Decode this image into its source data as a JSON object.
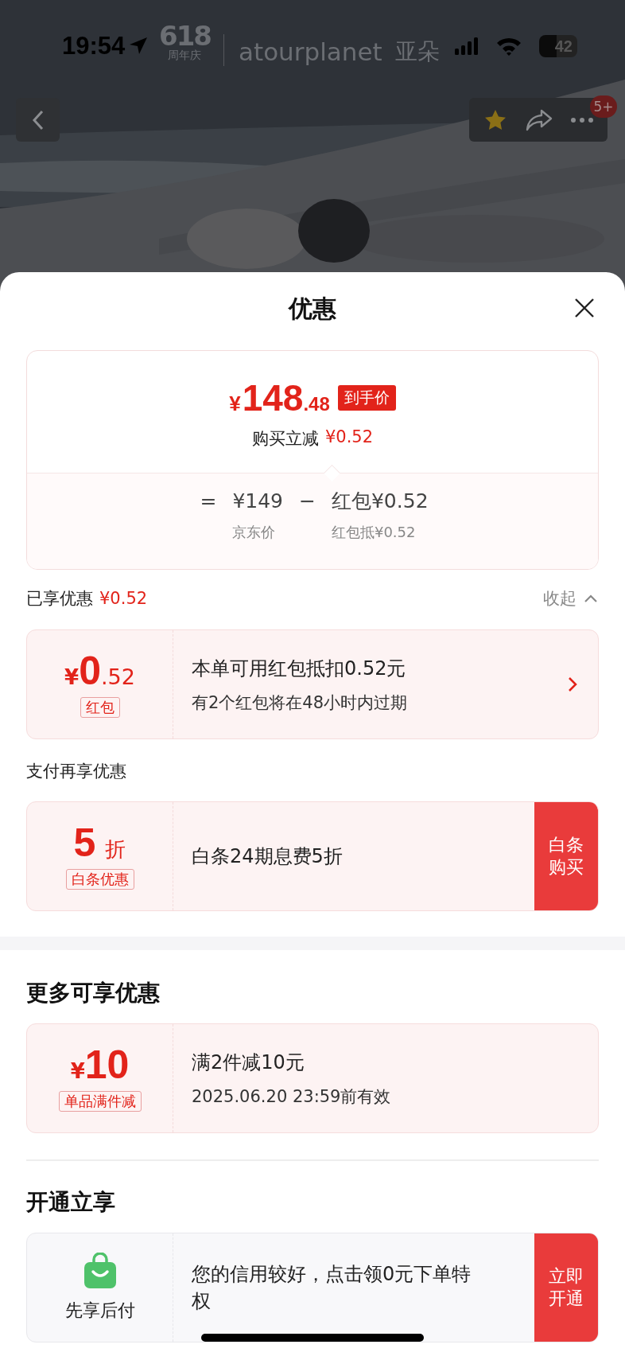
{
  "status_bar": {
    "time": "19:54",
    "battery": "42"
  },
  "brand": {
    "event_number": "618",
    "event_label": "周年庆",
    "name": "atourplanet",
    "name_cn": "亚朵"
  },
  "nav": {
    "favorited": true,
    "badge": "5+"
  },
  "sheet": {
    "title": "优惠"
  },
  "price_card": {
    "currency": "¥",
    "integer": "148",
    "decimal": ".48",
    "price_badge": "到手价",
    "saving_label": "购买立减",
    "saving_amount": "¥0.52",
    "breakdown": [
      {
        "kind": "operator",
        "text": "="
      },
      {
        "kind": "term",
        "value": "¥149",
        "caption": "京东价"
      },
      {
        "kind": "operator",
        "text": "−"
      },
      {
        "kind": "term",
        "value": "红包¥0.52",
        "caption": "红包抵¥0.52"
      }
    ]
  },
  "applied": {
    "label": "已享优惠",
    "amount": "¥0.52",
    "toggle": "收起",
    "expanded": true,
    "coupons": [
      {
        "kind": "coupon",
        "left": {
          "kind": "amount",
          "currency": "¥",
          "integer": "0",
          "decimal": ".52",
          "tag": "红包"
        },
        "lines": [
          "本单可用红包抵扣0.52元",
          "有2个红包将在48小时内过期"
        ],
        "action": {
          "kind": "chevron"
        }
      }
    ]
  },
  "payment": {
    "label": "支付再享优惠",
    "coupons": [
      {
        "kind": "coupon",
        "left": {
          "kind": "discount",
          "value": "5",
          "unit": "折",
          "tag": "白条优惠"
        },
        "lines": [
          "白条24期息费5折"
        ],
        "action": {
          "kind": "button",
          "label": "白条购买"
        }
      }
    ]
  },
  "more": {
    "heading": "更多可享优惠",
    "coupons": [
      {
        "kind": "coupon",
        "left": {
          "kind": "amount",
          "currency": "¥",
          "integer": "10",
          "tag": "单品满件减"
        },
        "lines": [
          "满2件减10元",
          "2025.06.20 23:59前有效"
        ]
      }
    ]
  },
  "activate": {
    "heading": "开通立享",
    "coupons": [
      {
        "kind": "service",
        "left": {
          "kind": "icon",
          "label": "先享后付"
        },
        "lines": [
          "您的信用较好，点击领0元下单特权"
        ],
        "action": {
          "kind": "button",
          "label": "立即开通"
        }
      }
    ]
  }
}
